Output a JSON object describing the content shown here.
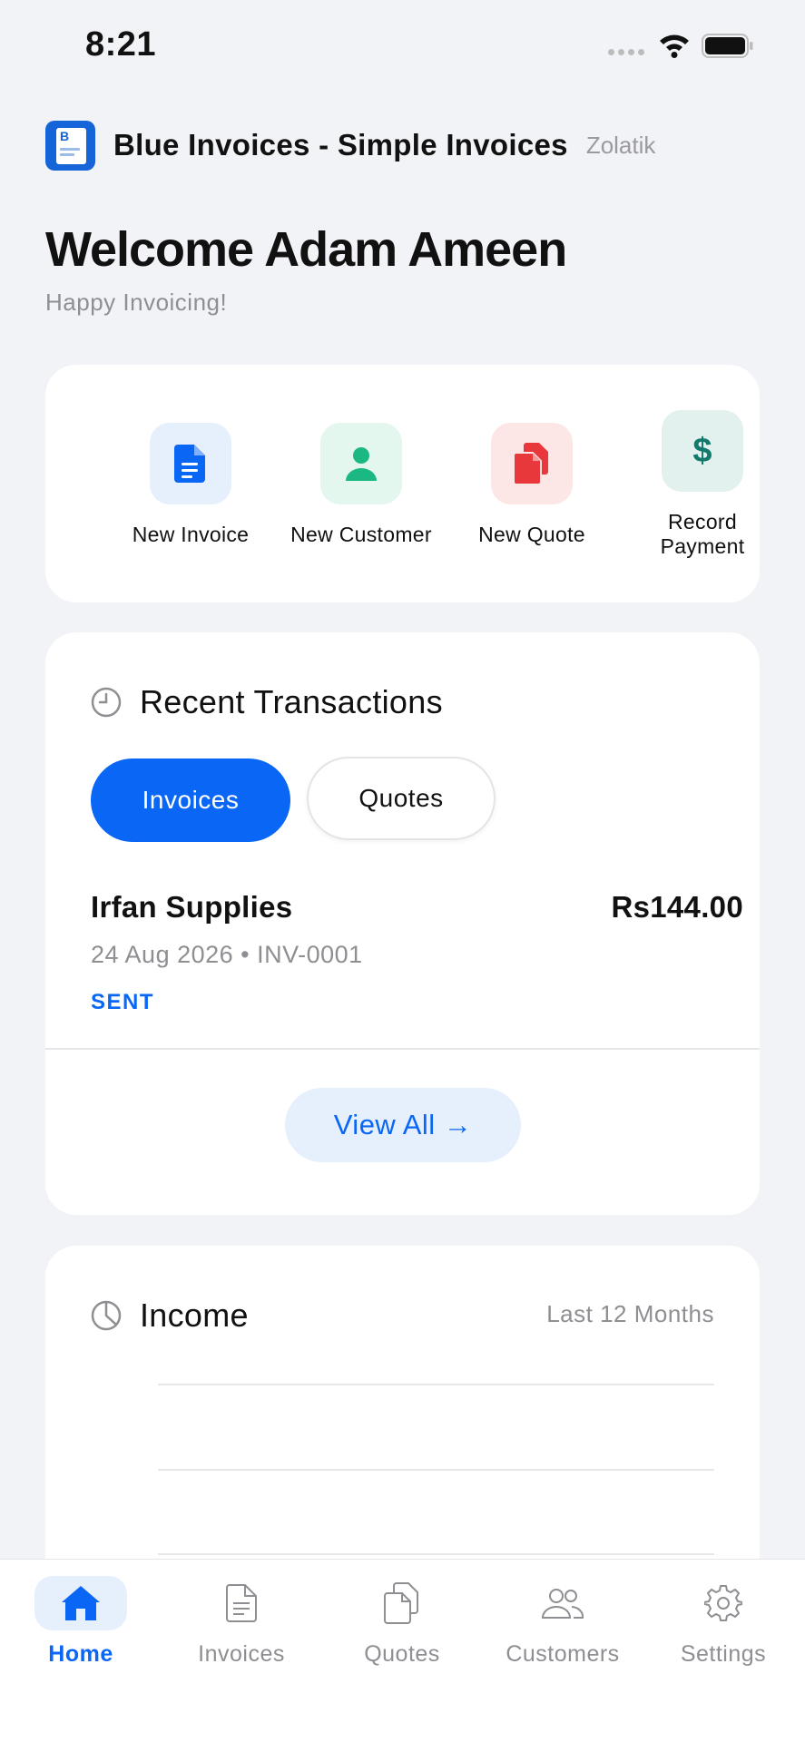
{
  "status_bar": {
    "time": "8:21"
  },
  "app": {
    "title": "Blue Invoices - Simple Invoices",
    "developer": "Zolatik",
    "logo_letter": "B"
  },
  "welcome": {
    "title": "Welcome Adam Ameen",
    "subtitle": "Happy Invoicing!"
  },
  "actions": [
    {
      "label": "New Invoice",
      "icon": "document-icon",
      "color": "#0a66f5",
      "bg": "#e6f0fd"
    },
    {
      "label": "New Customer",
      "icon": "person-icon",
      "color": "#1cb884",
      "bg": "#e4f7ef"
    },
    {
      "label": "New Quote",
      "icon": "copy-documents-icon",
      "color": "#e8383b",
      "bg": "#fde6e6"
    },
    {
      "label": "Record Payment",
      "icon": "dollar-icon",
      "color": "#127a6c",
      "bg": "#e3f1ee"
    }
  ],
  "recent": {
    "title": "Recent Transactions",
    "tabs": [
      {
        "label": "Invoices",
        "active": true
      },
      {
        "label": "Quotes",
        "active": false
      }
    ],
    "transactions": [
      {
        "name": "Irfan Supplies",
        "amount": "Rs144.00",
        "meta": "24 Aug 2026 • INV-0001",
        "status": "SENT"
      }
    ],
    "view_all": "View All →"
  },
  "income": {
    "title": "Income",
    "range": "Last 12 Months"
  },
  "tab_bar": [
    {
      "label": "Home",
      "icon": "home-icon",
      "active": true
    },
    {
      "label": "Invoices",
      "icon": "invoice-icon",
      "active": false
    },
    {
      "label": "Quotes",
      "icon": "quotes-icon",
      "active": false
    },
    {
      "label": "Customers",
      "icon": "customers-icon",
      "active": false
    },
    {
      "label": "Settings",
      "icon": "gear-icon",
      "active": false
    }
  ],
  "colors": {
    "accent": "#0a66f5",
    "background": "#f2f3f7",
    "muted": "#8e8e93"
  }
}
